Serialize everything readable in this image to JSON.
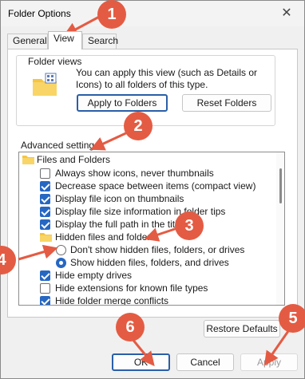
{
  "dialog": {
    "title": "Folder Options",
    "close_glyph": "✕"
  },
  "tabs": [
    {
      "label": "General"
    },
    {
      "label": "View"
    },
    {
      "label": "Search"
    }
  ],
  "active_tab": "View",
  "folder_views": {
    "heading": "Folder views",
    "description": "You can apply this view (such as Details or Icons) to all folders of this type.",
    "apply_button": "Apply to Folders",
    "reset_button": "Reset Folders"
  },
  "advanced": {
    "heading": "Advanced settings:",
    "items": [
      {
        "kind": "folder",
        "label": "Files and Folders"
      },
      {
        "kind": "checkbox",
        "checked": false,
        "label": "Always show icons, never thumbnails"
      },
      {
        "kind": "checkbox",
        "checked": true,
        "label": "Decrease space between items (compact view)"
      },
      {
        "kind": "checkbox",
        "checked": true,
        "label": "Display file icon on thumbnails"
      },
      {
        "kind": "checkbox",
        "checked": true,
        "label": "Display file size information in folder tips"
      },
      {
        "kind": "checkbox",
        "checked": true,
        "label": "Display the full path in the title bar"
      },
      {
        "kind": "folder",
        "label": "Hidden files and folders"
      },
      {
        "kind": "radio",
        "checked": false,
        "label": "Don't show hidden files, folders, or drives"
      },
      {
        "kind": "radio",
        "checked": true,
        "label": "Show hidden files, folders, and drives"
      },
      {
        "kind": "checkbox",
        "checked": true,
        "label": "Hide empty drives"
      },
      {
        "kind": "checkbox",
        "checked": false,
        "label": "Hide extensions for known file types"
      },
      {
        "kind": "checkbox",
        "checked": true,
        "label": "Hide folder merge conflicts"
      }
    ]
  },
  "restore_button": "Restore Defaults",
  "footer": {
    "ok": "OK",
    "cancel": "Cancel",
    "apply": "Apply"
  },
  "callouts": [
    "1",
    "2",
    "3",
    "4",
    "5",
    "6"
  ],
  "colors": {
    "callout": "#e45b43",
    "accent": "#2667c3",
    "folder": "#f5c542"
  },
  "icons": {
    "close": "close-icon",
    "folder_view": "folder-grid-icon",
    "tree_folder": "folder-icon"
  }
}
